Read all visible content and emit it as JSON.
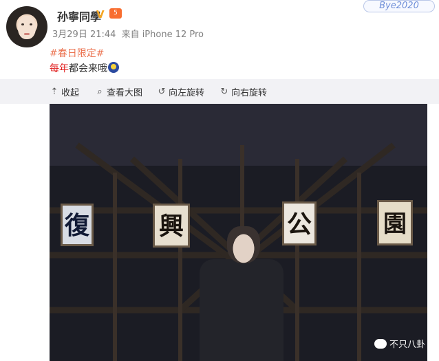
{
  "post": {
    "username": "孙寧同學",
    "vip_badge": "V",
    "level_badge": "5",
    "date": "3月29日 21:44",
    "source": "来自 iPhone 12 Pro",
    "topic": "#春日限定#",
    "text_highlight": "每年",
    "text_rest": "都会来哦",
    "emoji": "moon-emoji",
    "watermark": "Bye2020"
  },
  "toolbar": {
    "collapse": "收起",
    "view_large": "查看大图",
    "rotate_left": "向左旋转",
    "rotate_right": "向右旋转"
  },
  "photo": {
    "sign_1": "復",
    "sign_2": "興",
    "sign_3": "公",
    "sign_4": "園",
    "credit": "不只八卦"
  }
}
